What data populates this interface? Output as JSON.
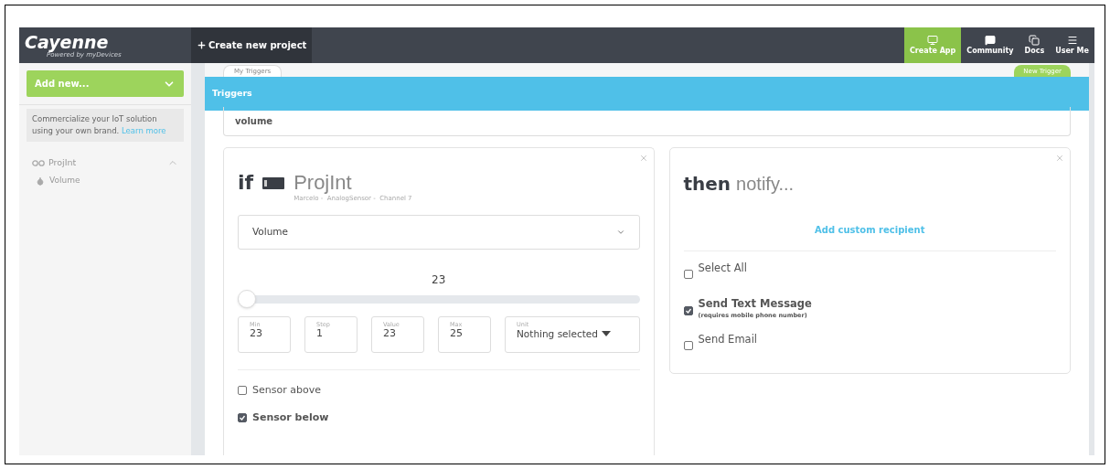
{
  "header": {
    "logo": "Cayenne",
    "logo_tagline": "Powered by myDevices",
    "create_project": "Create new project",
    "nav": [
      {
        "label": "Create App",
        "kind": "app",
        "selected": true
      },
      {
        "label": "Community",
        "kind": "community",
        "selected": false
      },
      {
        "label": "Docs",
        "kind": "docs",
        "selected": false
      },
      {
        "label": "User Me",
        "kind": "menu",
        "selected": false
      }
    ]
  },
  "sidebar": {
    "add_button": "Add new...",
    "promo": {
      "text": "Commercialize your IoT solution using your own brand.",
      "link": "Learn more"
    },
    "tree": [
      {
        "label": "ProjInt",
        "expanded": true,
        "children": [
          {
            "label": "Volume"
          }
        ]
      }
    ]
  },
  "tabs": [
    {
      "label": "My Triggers",
      "selected": false
    }
  ],
  "new_trigger": "New Trigger",
  "banner": "Triggers",
  "trigger_name": "volume",
  "if_card": {
    "keyword": "if",
    "device": "ProjInt",
    "device_path": "Marcelo -  AnalogSensor -  Channel 7",
    "channel_select": "Volume",
    "slider_value": "23",
    "level": 0,
    "fields": [
      {
        "label": "Min",
        "value": "23"
      },
      {
        "label": "Step",
        "value": "1"
      },
      {
        "label": "Value",
        "value": "23"
      },
      {
        "label": "Max",
        "value": "25"
      }
    ],
    "unit": {
      "label": "Unit",
      "value": "Nothing selected"
    },
    "options": [
      {
        "label": "Sensor above",
        "checked": false
      },
      {
        "label": "Sensor below",
        "checked": true
      }
    ]
  },
  "then_card": {
    "keyword": "then",
    "action": "notify...",
    "add_recipient": "Add custom recipient",
    "options": [
      {
        "label": "Select All",
        "checked": false
      },
      {
        "label": "Send Text Message",
        "note": "(requires mobile phone number)",
        "checked": true
      },
      {
        "label": "Send Email",
        "checked": false
      }
    ]
  }
}
